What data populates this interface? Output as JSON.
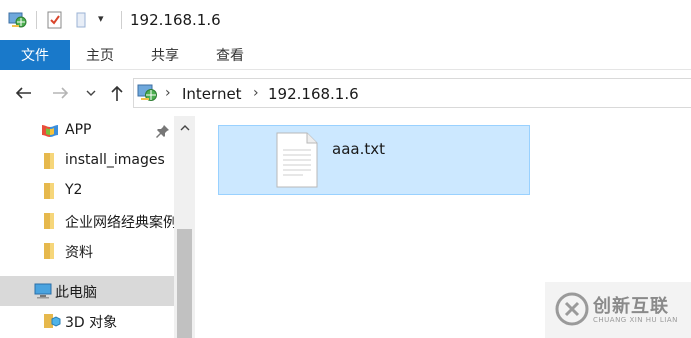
{
  "window": {
    "title": "192.168.1.6"
  },
  "ribbon": {
    "tabs": [
      "文件",
      "主页",
      "共享",
      "查看"
    ]
  },
  "address": {
    "crumbs": [
      "Internet",
      "192.168.1.6"
    ]
  },
  "nav_pane": {
    "items": [
      {
        "label": "APP",
        "icon": "app-icon",
        "pinned": true
      },
      {
        "label": "install_images",
        "icon": "folder-icon"
      },
      {
        "label": "Y2",
        "icon": "folder-icon"
      },
      {
        "label": "企业网络经典案例",
        "icon": "folder-icon"
      },
      {
        "label": "资料",
        "icon": "folder-icon"
      },
      {
        "label": "此电脑",
        "icon": "computer-icon",
        "selected": true
      },
      {
        "label": "3D 对象",
        "icon": "3d-objects-icon"
      }
    ]
  },
  "content": {
    "files": [
      {
        "name": "aaa.txt",
        "icon": "text-file-icon",
        "selected": true
      }
    ]
  },
  "watermark": {
    "title": "创新互联",
    "subtitle": "CHUANG XIN HU LIAN"
  },
  "colors": {
    "accent": "#1979ca",
    "selection": "#cce8ff",
    "selection_border": "#99d1ff",
    "nav_selected": "#d9d9d9"
  }
}
